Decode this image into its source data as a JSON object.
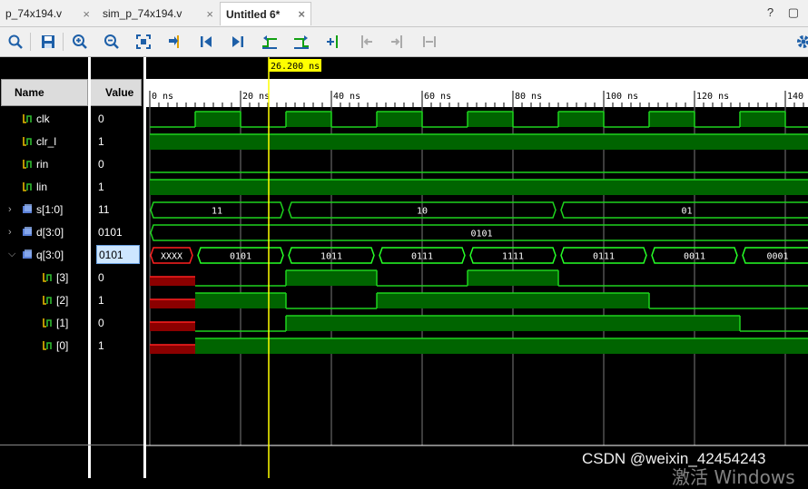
{
  "tabs": [
    {
      "label": "p_74x194.v",
      "close": "×"
    },
    {
      "label": "sim_p_74x194.v",
      "close": "×"
    },
    {
      "label": "Untitled 6*",
      "close": "×"
    }
  ],
  "window_controls": "? ▢",
  "toolbar": {
    "icons": [
      "search-icon",
      "save-icon",
      "zoom-in-icon",
      "zoom-out-icon",
      "zoom-fit-icon",
      "go-to-cursor-icon",
      "go-to-start-icon",
      "go-to-end-icon",
      "previous-transition-icon",
      "next-transition-icon",
      "add-marker-icon",
      "previous-marker-icon",
      "next-marker-icon",
      "swap-cursors-icon",
      "settings-icon"
    ]
  },
  "columns": {
    "name": "Name",
    "value": "Value"
  },
  "cursor": {
    "label": "26.200 ns",
    "time_ns": 26.2
  },
  "timeline": {
    "start_ns": 0,
    "ns_per_label": 20,
    "labels": [
      "0 ns",
      "20 ns",
      "40 ns",
      "60 ns",
      "80 ns",
      "100 ns",
      "120 ns",
      "140"
    ]
  },
  "signals": [
    {
      "name": "clk",
      "value": "0",
      "type": "bit",
      "expander": ""
    },
    {
      "name": "clr_l",
      "value": "1",
      "type": "bit",
      "expander": ""
    },
    {
      "name": "rin",
      "value": "0",
      "type": "bit",
      "expander": ""
    },
    {
      "name": "lin",
      "value": "1",
      "type": "bit",
      "expander": ""
    },
    {
      "name": "s[1:0]",
      "value": "11",
      "type": "bus",
      "expander": ">"
    },
    {
      "name": "d[3:0]",
      "value": "0101",
      "type": "bus",
      "expander": ">"
    },
    {
      "name": "q[3:0]",
      "value": "0101",
      "type": "bus",
      "expander": "v",
      "selected": true
    },
    {
      "name": "[3]",
      "value": "0",
      "type": "bit",
      "expander": "",
      "child": true
    },
    {
      "name": "[2]",
      "value": "1",
      "type": "bit",
      "expander": "",
      "child": true
    },
    {
      "name": "[1]",
      "value": "0",
      "type": "bit",
      "expander": "",
      "child": true
    },
    {
      "name": "[0]",
      "value": "1",
      "type": "bit",
      "expander": "",
      "child": true
    }
  ],
  "bus_labels": {
    "s": [
      "11",
      "10",
      "01"
    ],
    "d": [
      "0101"
    ],
    "q": [
      "XXXX",
      "0101",
      "1011",
      "0111",
      "1111",
      "0111",
      "0011",
      "0001"
    ]
  },
  "watermark": "CSDN @weixin_42454243",
  "windows_mark": "激活 Windows"
}
